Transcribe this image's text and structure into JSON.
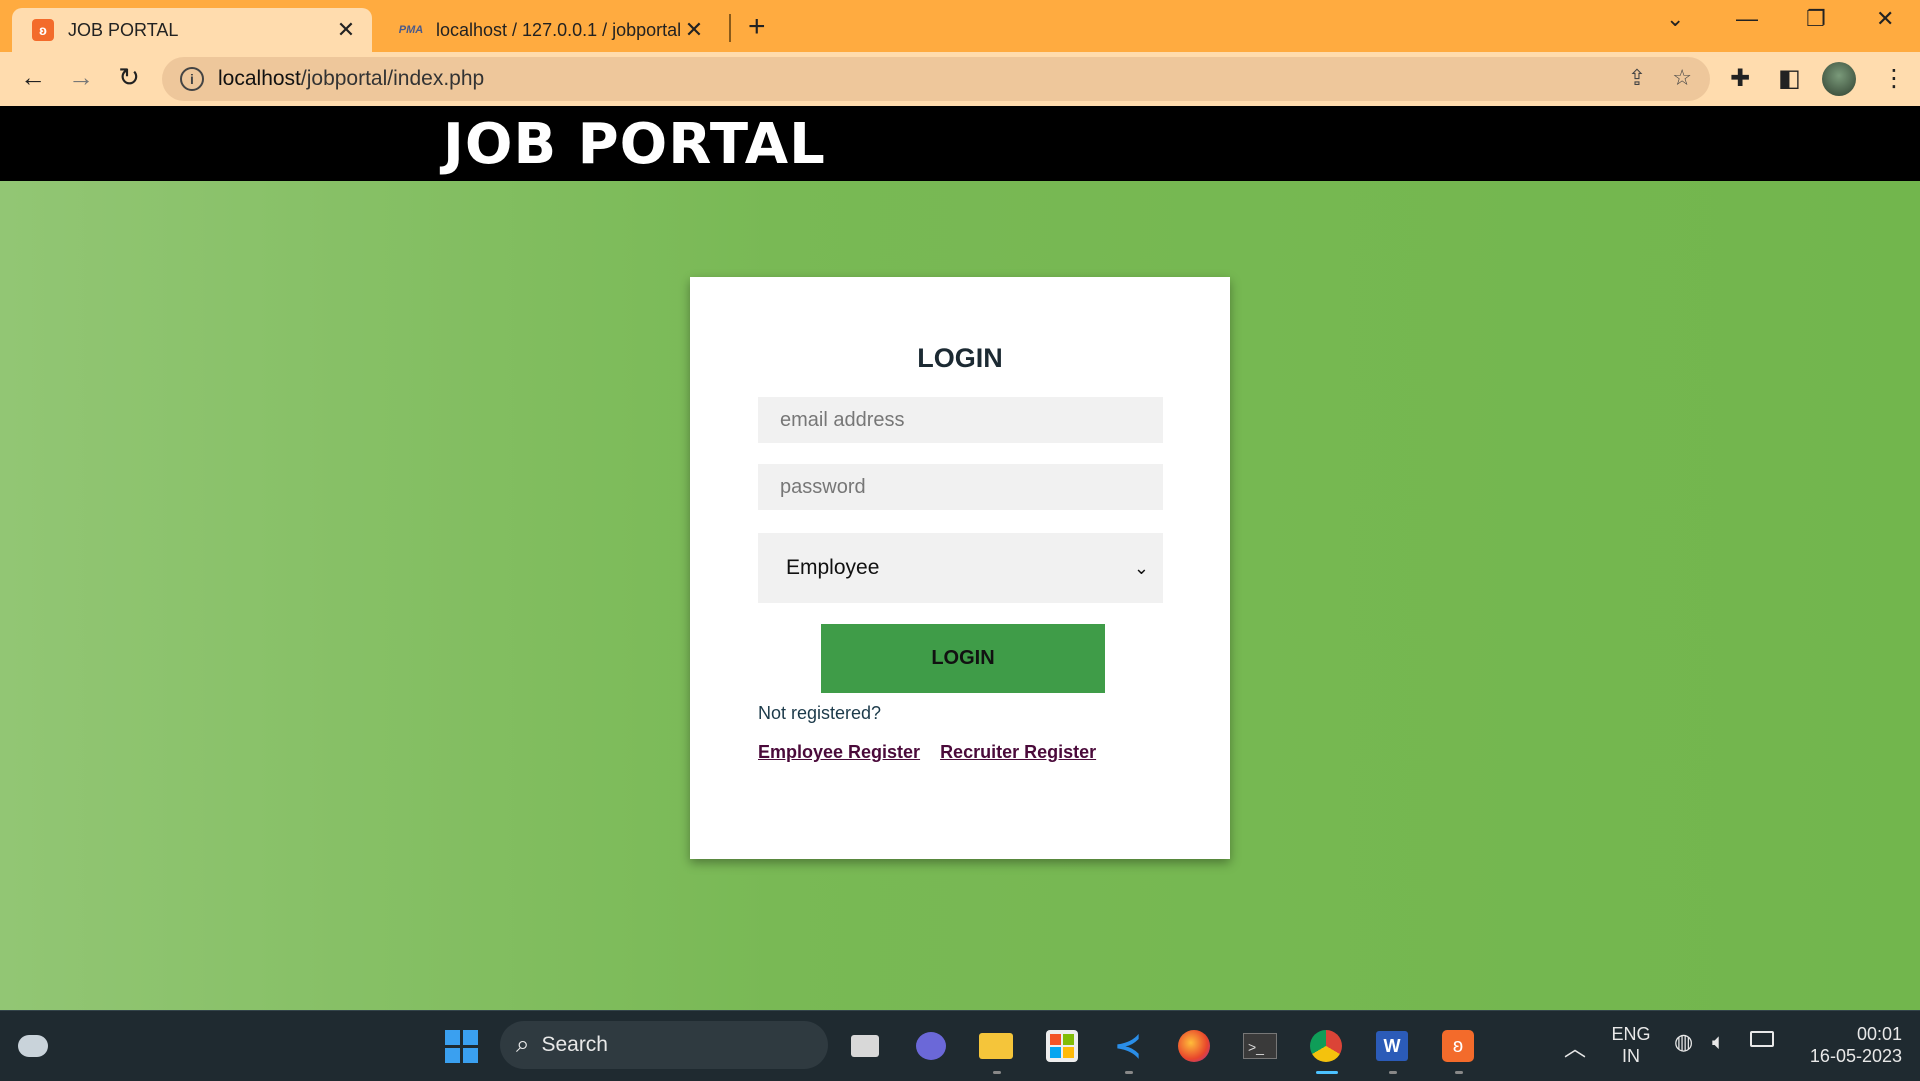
{
  "browser": {
    "tabs": [
      {
        "title": "JOB PORTAL",
        "active": true
      },
      {
        "title": "localhost / 127.0.0.1 / jobportal /",
        "active": false
      }
    ],
    "url_domain": "localhost",
    "url_path": "/jobportal/index.php",
    "colors": {
      "tabbar": "#ffab40",
      "toolbar": "#ffdcae"
    }
  },
  "site": {
    "title": "JOB PORTAL"
  },
  "login": {
    "heading": "LOGIN",
    "email_placeholder": "email address",
    "password_placeholder": "password",
    "role_selected": "Employee",
    "button_label": "LOGIN",
    "not_registered": "Not registered?",
    "employee_register": "Employee Register",
    "recruiter_register": "Recruiter Register",
    "colors": {
      "button": "#3f9c48",
      "background": "#7dbb5a",
      "link": "#4a0a3a"
    }
  },
  "taskbar": {
    "search_label": "Search",
    "language_line1": "ENG",
    "language_line2": "IN",
    "time": "00:01",
    "date": "16-05-2023"
  }
}
